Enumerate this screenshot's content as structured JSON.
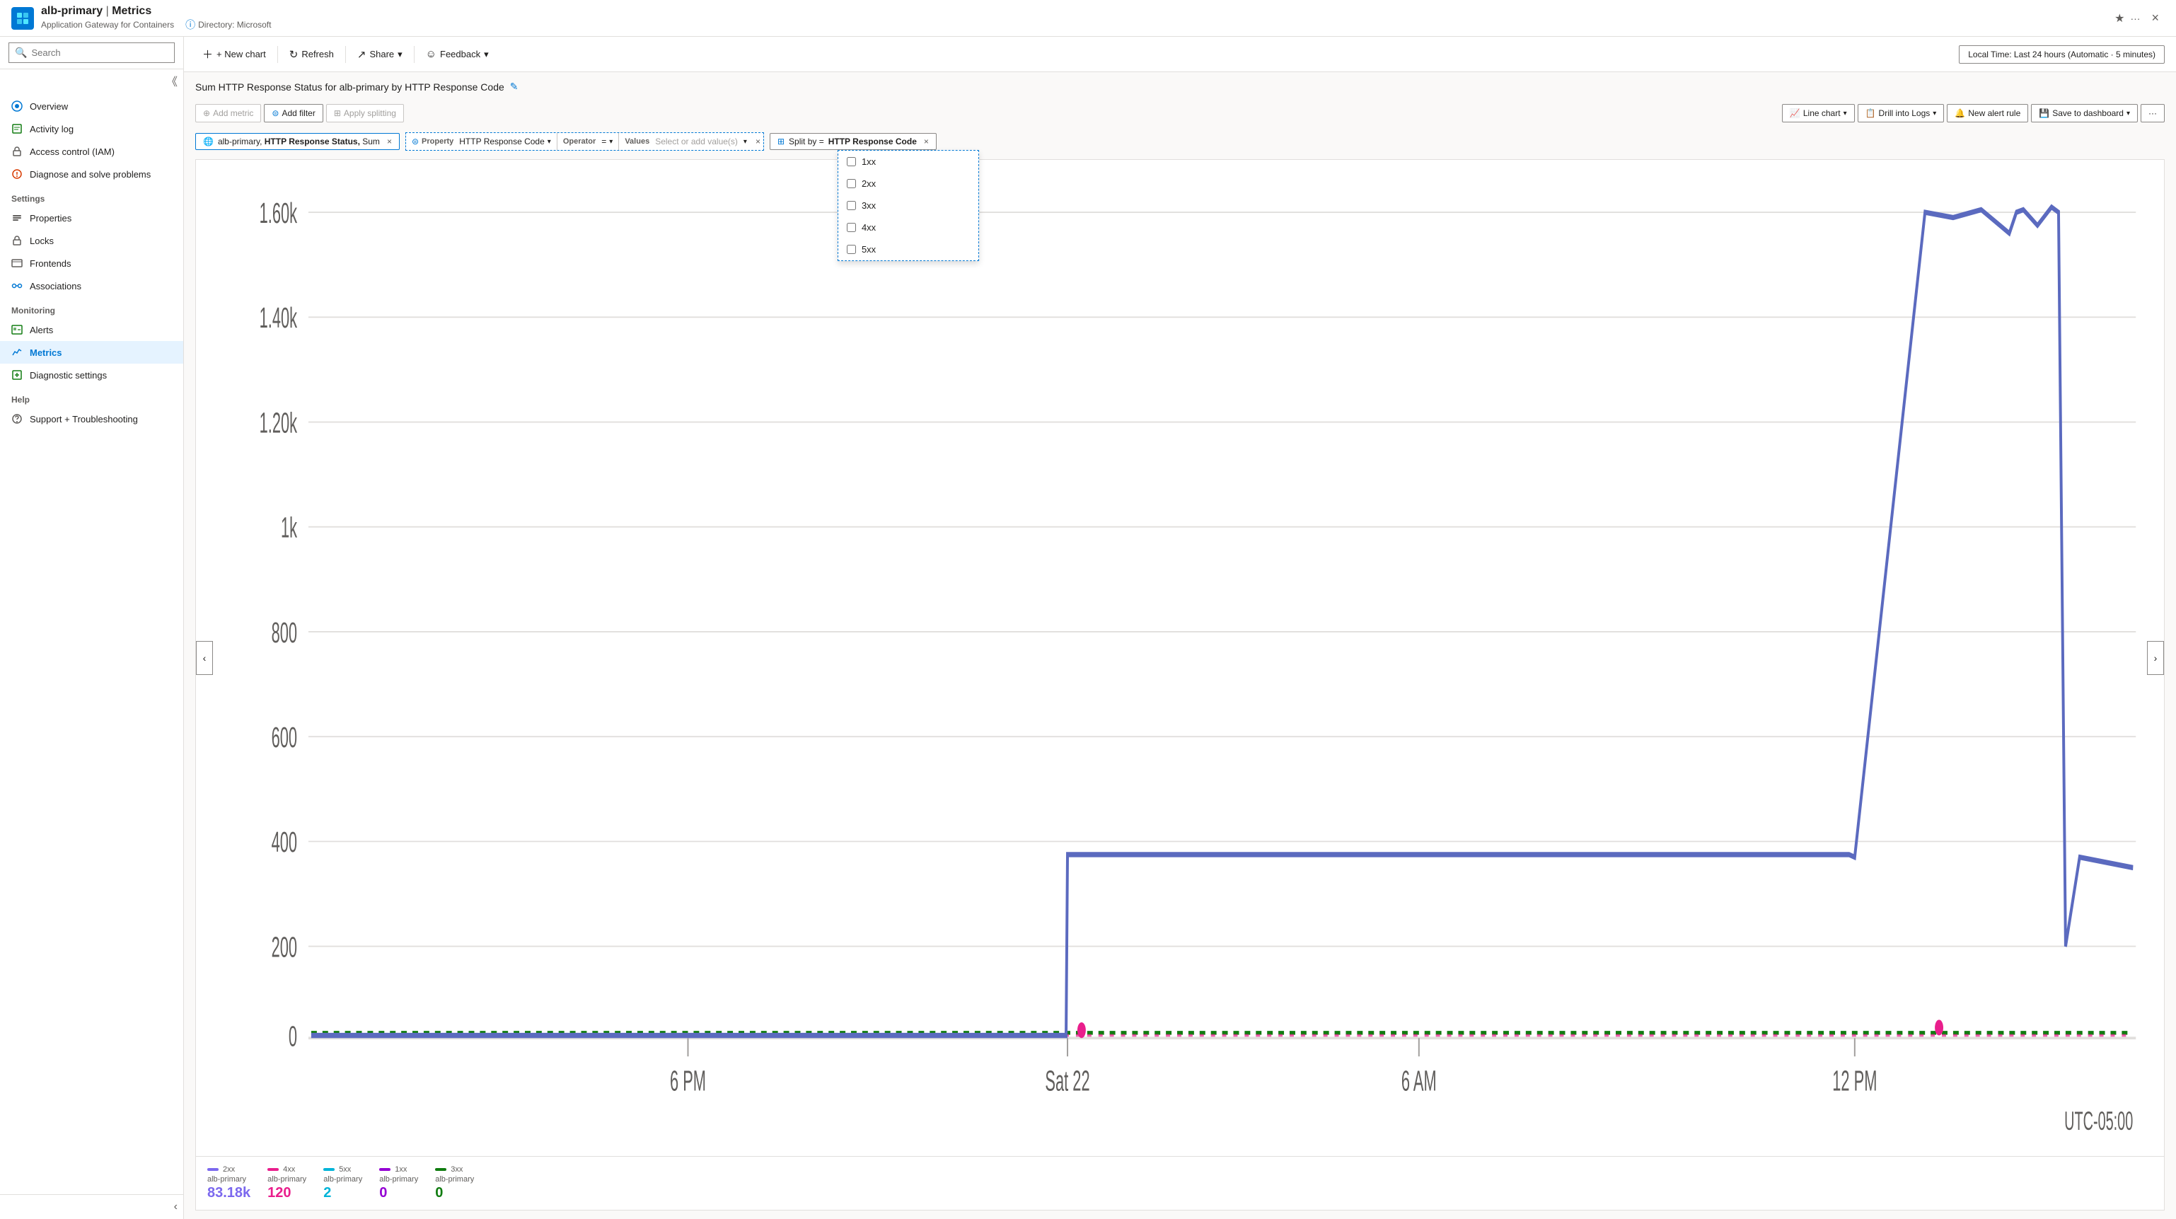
{
  "titleBar": {
    "appName": "alb-primary",
    "separator": "|",
    "pageName": "Metrics",
    "subtitle": "Application Gateway for Containers",
    "directory": "Directory: Microsoft",
    "closeLabel": "×",
    "favIcon": "★",
    "moreIcon": "···"
  },
  "toolbar": {
    "newChart": "+ New chart",
    "refresh": "Refresh",
    "share": "Share",
    "feedback": "Feedback",
    "timeRange": "Local Time: Last 24 hours (Automatic · 5 minutes)"
  },
  "chart": {
    "title": "Sum HTTP Response Status for alb-primary by HTTP Response Code",
    "editIcon": "✎",
    "toolbar": {
      "addMetric": "Add metric",
      "addFilter": "Add filter",
      "applySplitting": "Apply splitting",
      "lineChart": "Line chart",
      "drillIntoLogs": "Drill into Logs",
      "newAlertRule": "New alert rule",
      "saveToDashboard": "Save to dashboard",
      "moreIcon": "···"
    }
  },
  "filter": {
    "metricLabel": "alb-primary,",
    "metricBold": "HTTP Response Status,",
    "metricAgg": "Sum",
    "filterIcon": "⊜",
    "property": "HTTP Response Code",
    "operator": "=",
    "valuesPlaceholder": "Select or add value(s)",
    "splitLabel": "Split by =",
    "splitValue": "HTTP Response Code"
  },
  "dropdown": {
    "items": [
      {
        "label": "1xx",
        "checked": false
      },
      {
        "label": "2xx",
        "checked": false
      },
      {
        "label": "3xx",
        "checked": false
      },
      {
        "label": "4xx",
        "checked": false
      },
      {
        "label": "5xx",
        "checked": false
      }
    ]
  },
  "chartData": {
    "yLabels": [
      "1.60k",
      "1.40k",
      "1.20k",
      "1k",
      "800",
      "600",
      "400",
      "200",
      "0"
    ],
    "xLabels": [
      "6 PM",
      "Sat 22",
      "6 AM",
      "12 PM"
    ],
    "utcLabel": "UTC-05:00"
  },
  "legend": [
    {
      "colorHex": "#7b68ee",
      "label": "2xx",
      "sublabel": "alb-primary",
      "value": "83.18k"
    },
    {
      "colorHex": "#e91e8c",
      "label": "4xx",
      "sublabel": "alb-primary",
      "value": "120"
    },
    {
      "colorHex": "#00b4d8",
      "label": "5xx",
      "sublabel": "alb-primary",
      "value": "2"
    },
    {
      "colorHex": "#9400d3",
      "label": "1xx",
      "sublabel": "alb-primary",
      "value": "0"
    },
    {
      "colorHex": "#107c10",
      "label": "3xx",
      "sublabel": "alb-primary",
      "value": "0"
    }
  ],
  "sidebar": {
    "searchPlaceholder": "Search",
    "items": [
      {
        "label": "Overview",
        "icon": "overview",
        "section": null,
        "active": false
      },
      {
        "label": "Activity log",
        "icon": "activity",
        "section": null,
        "active": false
      },
      {
        "label": "Access control (IAM)",
        "icon": "iam",
        "section": null,
        "active": false
      },
      {
        "label": "Diagnose and solve problems",
        "icon": "diagnose",
        "section": null,
        "active": false
      },
      {
        "label": "Settings",
        "icon": null,
        "section": "Settings",
        "active": false
      },
      {
        "label": "Properties",
        "icon": "properties",
        "section": "Settings",
        "active": false
      },
      {
        "label": "Locks",
        "icon": "locks",
        "section": "Settings",
        "active": false
      },
      {
        "label": "Frontends",
        "icon": "frontends",
        "section": "Settings",
        "active": false
      },
      {
        "label": "Associations",
        "icon": "associations",
        "section": "Settings",
        "active": false
      },
      {
        "label": "Monitoring",
        "icon": null,
        "section": "Monitoring",
        "active": false
      },
      {
        "label": "Alerts",
        "icon": "alerts",
        "section": "Monitoring",
        "active": false
      },
      {
        "label": "Metrics",
        "icon": "metrics",
        "section": "Monitoring",
        "active": true
      },
      {
        "label": "Diagnostic settings",
        "icon": "diagnostic",
        "section": "Monitoring",
        "active": false
      },
      {
        "label": "Help",
        "icon": null,
        "section": "Help",
        "active": false
      },
      {
        "label": "Support + Troubleshooting",
        "icon": "support",
        "section": "Help",
        "active": false
      }
    ]
  }
}
